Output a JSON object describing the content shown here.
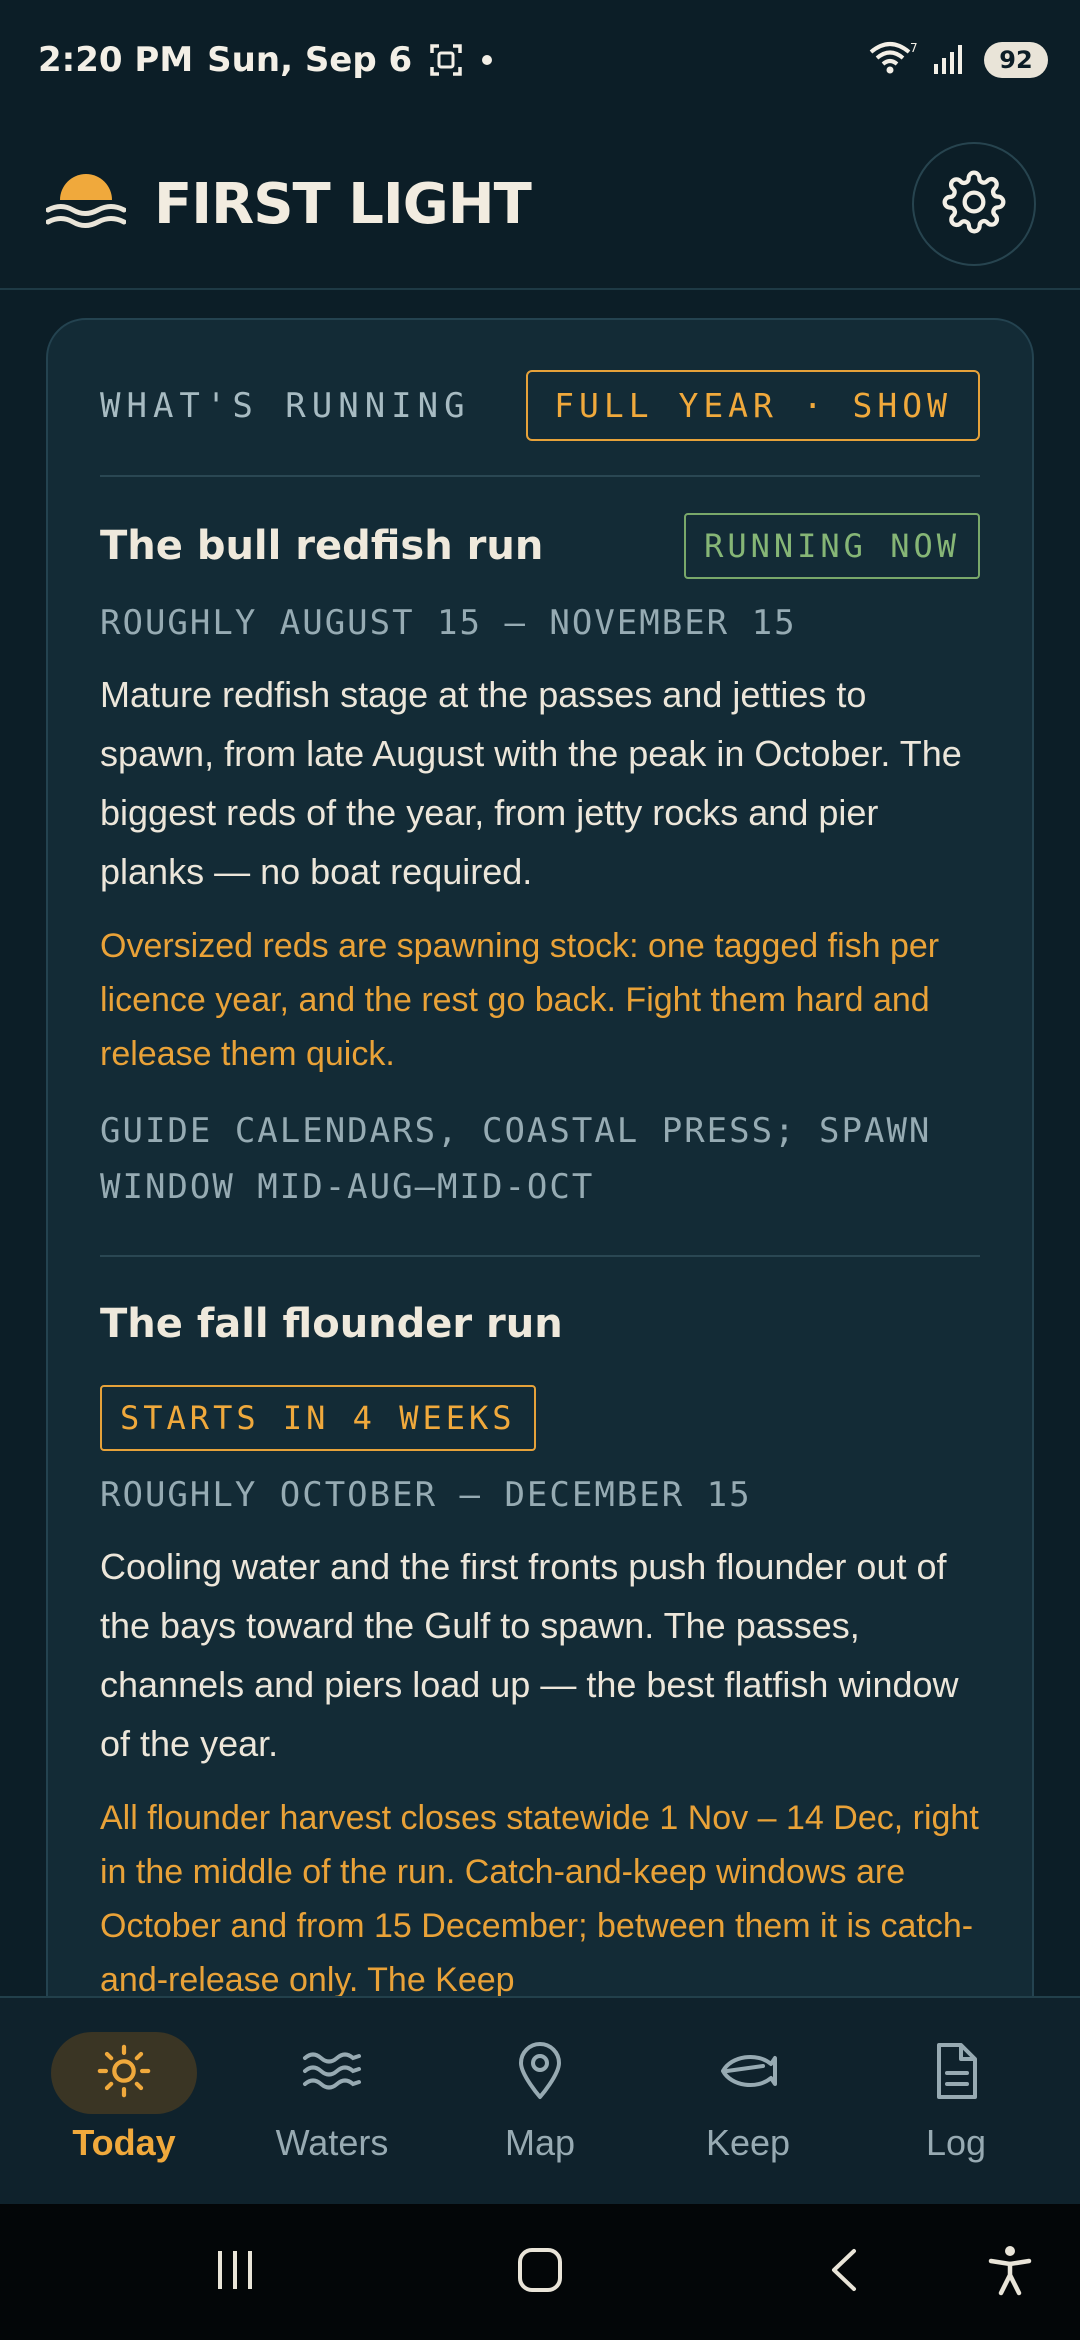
{
  "status_bar": {
    "time": "2:20 PM",
    "date": "Sun, Sep 6",
    "battery": "92",
    "icons": [
      "screenshot-icon",
      "dot-icon",
      "wifi-icon",
      "signal-icon",
      "battery-icon"
    ]
  },
  "header": {
    "app_title": "FIRST LIGHT",
    "logo_icon": "sunrise-logo-icon",
    "settings_icon": "gear-icon"
  },
  "running_card": {
    "title": "WHAT'S RUNNING",
    "toggle_label": "FULL YEAR · SHOW",
    "runs": [
      {
        "name": "The bull redfish run",
        "status": "RUNNING NOW",
        "dates": "ROUGHLY AUGUST 15 – NOVEMBER 15",
        "description": "Mature redfish stage at the passes and jetties to spawn, from late August with the peak in October. The biggest reds of the year, from jetty rocks and pier planks — no boat required.",
        "note": "Oversized reds are spawning stock: one tagged fish per licence year, and the rest go back. Fight them hard and release them quick.",
        "source": "GUIDE CALENDARS, COASTAL PRESS; SPAWN WINDOW MID-AUG–MID-OCT"
      },
      {
        "name": "The fall flounder run",
        "status": "STARTS IN 4 WEEKS",
        "dates": "ROUGHLY OCTOBER – DECEMBER 15",
        "description": "Cooling water and the first fronts push flounder out of the bays toward the Gulf to spawn. The passes, channels and piers load up — the best flatfish window of the year.",
        "note": "All flounder harvest closes statewide 1 Nov – 14 Dec, right in the middle of the run. Catch-and-keep windows are October and from 15 December; between them it is catch-and-release only. The Keep"
      }
    ]
  },
  "bottom_nav": {
    "items": [
      {
        "label": "Today",
        "icon": "sun-icon",
        "active": true
      },
      {
        "label": "Waters",
        "icon": "waves-icon",
        "active": false
      },
      {
        "label": "Map",
        "icon": "map-pin-icon",
        "active": false
      },
      {
        "label": "Keep",
        "icon": "fish-icon",
        "active": false
      },
      {
        "label": "Log",
        "icon": "document-icon",
        "active": false
      }
    ]
  },
  "system_nav": {
    "icons": [
      "recents-icon",
      "home-icon",
      "back-icon",
      "accessibility-icon"
    ]
  },
  "colors": {
    "background": "#0c1e27",
    "card": "#132b36",
    "accent_amber": "#f0a93c",
    "accent_green": "#86b676",
    "text_primary": "#efe9dc",
    "text_muted": "#96abb3"
  }
}
